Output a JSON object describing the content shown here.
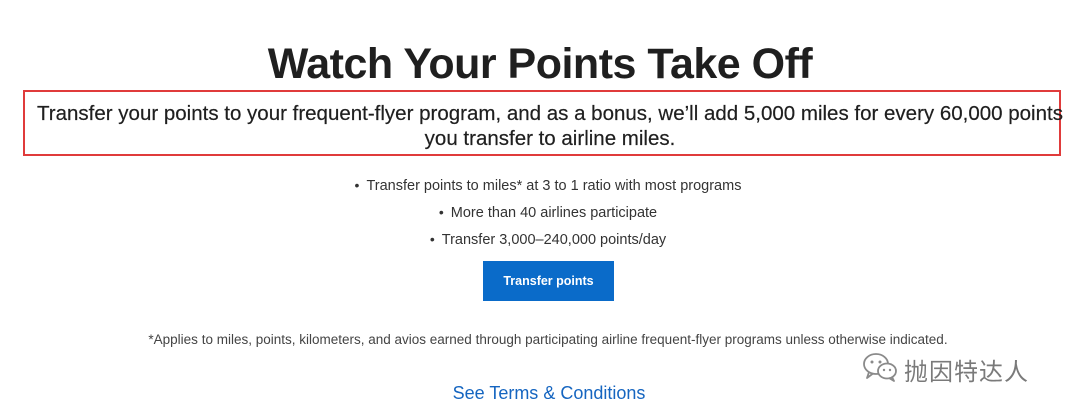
{
  "headline": "Watch Your Points Take Off",
  "bonus_message": "Transfer your points to your frequent-flyer program, and as a bonus, we’ll add 5,000 miles for every 60,000 points you transfer to airline miles.",
  "benefits": [
    "Transfer points to miles* at 3 to 1 ratio with most programs",
    "More than 40 airlines participate",
    "Transfer 3,000–240,000 points/day"
  ],
  "bullet_glyph": "•",
  "transfer_button_label": "Transfer points",
  "footnote": "*Applies to miles, points, kilometers, and avios earned through participating airline frequent-flyer programs unless otherwise indicated.",
  "terms_link_label": "See Terms & Conditions",
  "watermark": {
    "icon": "wechat-icon",
    "text": "抛因特达人"
  },
  "colors": {
    "highlight_border": "#e03b3b",
    "button_bg": "#0a6bc9",
    "link": "#1565c0"
  }
}
